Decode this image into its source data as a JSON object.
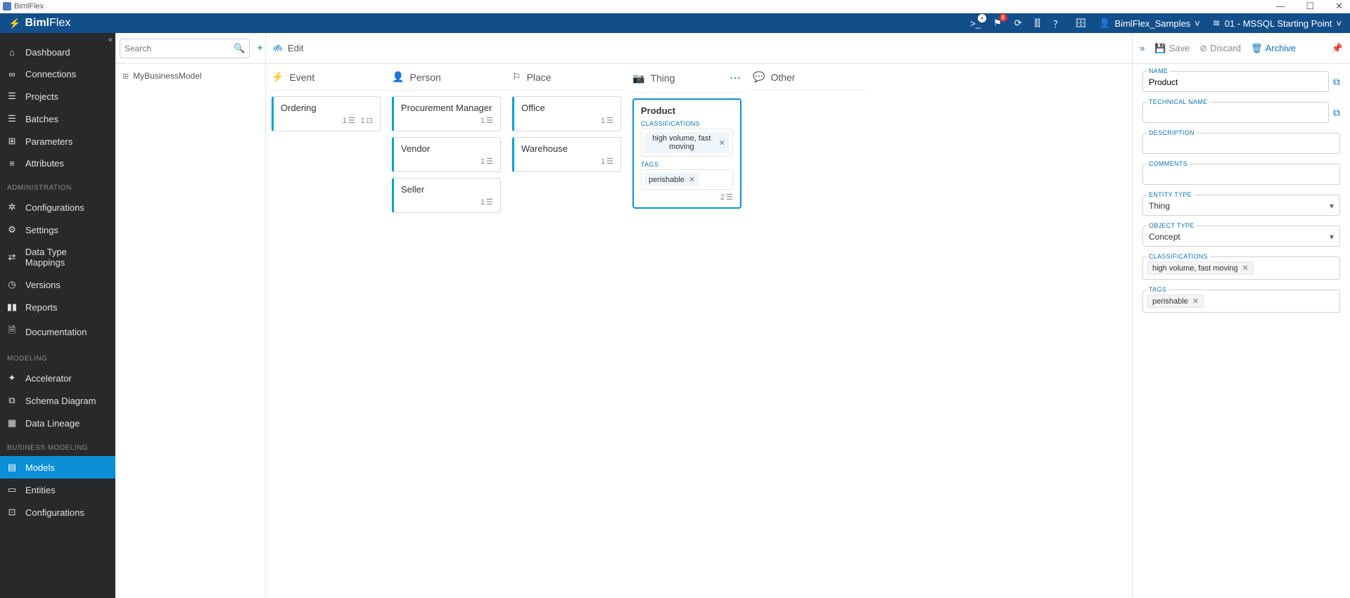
{
  "window": {
    "title": "BimlFlex"
  },
  "brand": {
    "name": "BimlFlex"
  },
  "topnav": {
    "flag_badge": "8",
    "customer_label": "BimlFlex_Samples",
    "version_label": "01 - MSSQL Starting Point"
  },
  "sidebar": {
    "items": [
      {
        "label": "Dashboard",
        "icon": "home"
      },
      {
        "label": "Connections",
        "icon": "link"
      },
      {
        "label": "Projects",
        "icon": "stack"
      },
      {
        "label": "Batches",
        "icon": "list"
      },
      {
        "label": "Parameters",
        "icon": "slider"
      },
      {
        "label": "Attributes",
        "icon": "lines"
      }
    ],
    "section_admin": "ADMINISTRATION",
    "admin": [
      {
        "label": "Configurations",
        "icon": "gear"
      },
      {
        "label": "Settings",
        "icon": "cog"
      },
      {
        "label": "Data Type Mappings",
        "icon": "swap"
      },
      {
        "label": "Versions",
        "icon": "tag"
      },
      {
        "label": "Reports",
        "icon": "bar"
      },
      {
        "label": "Documentation",
        "icon": "book"
      }
    ],
    "section_modeling": "MODELING",
    "modeling": [
      {
        "label": "Accelerator",
        "icon": "spark"
      },
      {
        "label": "Schema Diagram",
        "icon": "schema"
      },
      {
        "label": "Data Lineage",
        "icon": "grid"
      }
    ],
    "section_business": "BUSINESS MODELING",
    "business": [
      {
        "label": "Models",
        "icon": "model",
        "active": true
      },
      {
        "label": "Entities",
        "icon": "entity"
      },
      {
        "label": "Configurations",
        "icon": "conf"
      }
    ]
  },
  "search": {
    "placeholder": "Search"
  },
  "tree": {
    "root": "MyBusinessModel"
  },
  "edit": {
    "label": "Edit"
  },
  "columns": [
    {
      "key": "event",
      "title": "Event",
      "icon": "bolt",
      "cards": [
        {
          "title": "Ordering",
          "count": "1",
          "extra": "1"
        }
      ]
    },
    {
      "key": "person",
      "title": "Person",
      "icon": "person",
      "cards": [
        {
          "title": "Procurement Manager",
          "count": "1"
        },
        {
          "title": "Vendor",
          "count": "1"
        },
        {
          "title": "Seller",
          "count": "1"
        }
      ]
    },
    {
      "key": "place",
      "title": "Place",
      "icon": "place",
      "cards": [
        {
          "title": "Office",
          "count": "1"
        },
        {
          "title": "Warehouse",
          "count": "1"
        }
      ]
    },
    {
      "key": "thing",
      "title": "Thing",
      "icon": "thing",
      "menu": true,
      "cards": [
        {
          "title": "Product",
          "count": "2",
          "selected": true,
          "class_label": "CLASSIFICATIONS",
          "tags_label": "TAGS",
          "classifications": [
            "high volume, fast moving"
          ],
          "tags": [
            "perishable"
          ]
        }
      ]
    },
    {
      "key": "other",
      "title": "Other",
      "icon": "chat",
      "cards": []
    }
  ],
  "details_toolbar": {
    "expand": "»",
    "save": "Save",
    "discard": "Discard",
    "archive": "Archive"
  },
  "form": {
    "name_label": "NAME",
    "name_value": "Product",
    "tech_label": "TECHNICAL NAME",
    "tech_value": "",
    "desc_label": "DESCRIPTION",
    "desc_value": "",
    "comments_label": "COMMENTS",
    "comments_value": "",
    "etype_label": "ENTITY TYPE",
    "etype_value": "Thing",
    "otype_label": "OBJECT TYPE",
    "otype_value": "Concept",
    "class_label": "CLASSIFICATIONS",
    "class_chip": "high volume, fast moving",
    "tags_label": "TAGS",
    "tags_chip": "perishable"
  }
}
